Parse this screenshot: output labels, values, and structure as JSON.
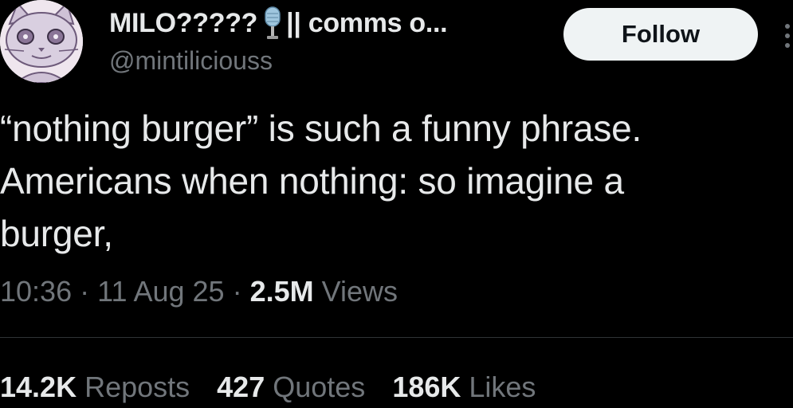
{
  "user": {
    "display_name": "MILO?????",
    "name_suffix": "|| comms o...",
    "badge_icon": "microphone-icon",
    "handle": "@mintiliciouss",
    "avatar_icon": "cat-drawing-avatar"
  },
  "actions": {
    "follow_label": "Follow",
    "more_icon": "more-options-icon"
  },
  "tweet": {
    "text": "“nothing burger” is such a funny phrase.\nAmericans when nothing: so imagine a\nburger,"
  },
  "meta": {
    "time": "10:36",
    "separator1": " · ",
    "date": "11 Aug 25",
    "separator2": " · ",
    "views_count": "2.5M",
    "views_label": " Views"
  },
  "stats": {
    "reposts_count": "14.2K",
    "reposts_label": "Reposts",
    "quotes_count": "427",
    "quotes_label": "Quotes",
    "likes_count": "186K",
    "likes_label": "Likes"
  },
  "colors": {
    "background": "#000000",
    "text_primary": "#e7e9ea",
    "text_secondary": "#71767b",
    "follow_bg": "#eff3f4",
    "follow_text": "#0f1419",
    "divider": "#2f3336"
  }
}
